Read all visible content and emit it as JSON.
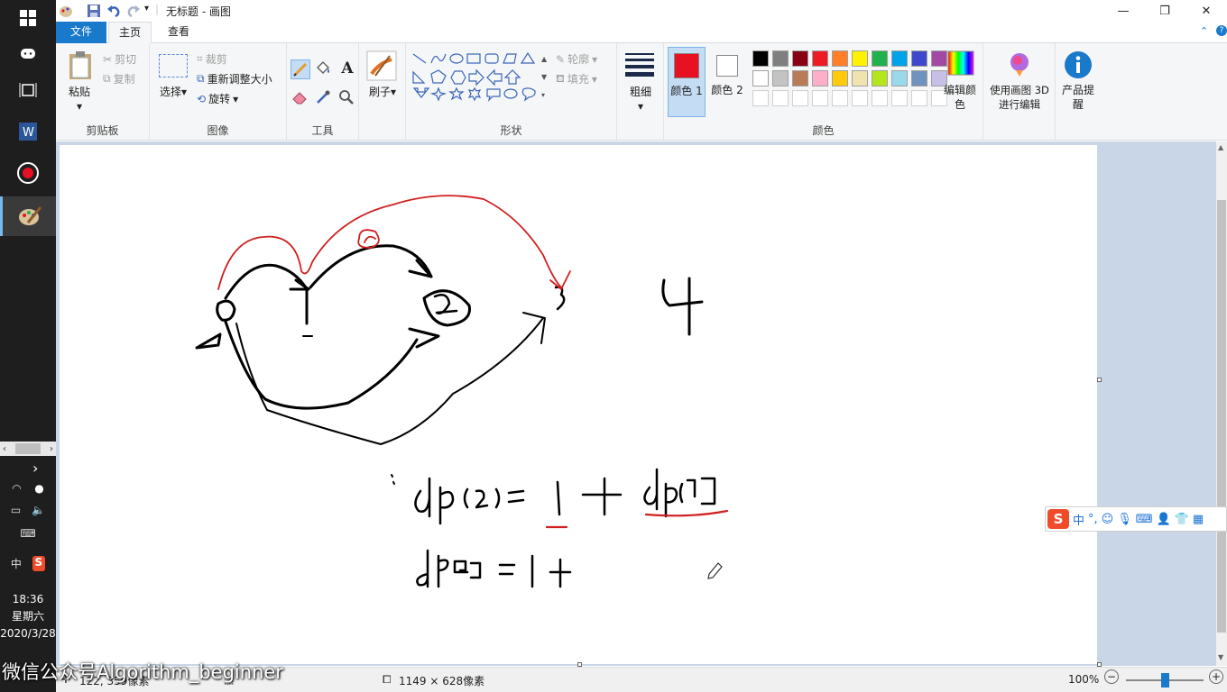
{
  "window": {
    "title": "无标题 - 画图"
  },
  "tabs": [
    "文件",
    "主页",
    "查看"
  ],
  "clipboard": {
    "paste": "粘贴",
    "cut": "剪切",
    "copy": "复制",
    "group": "剪贴板"
  },
  "image": {
    "select": "选择",
    "crop": "裁剪",
    "resize": "重新调整大小",
    "rotate": "旋转",
    "group": "图像"
  },
  "tools": {
    "text_icon": "A",
    "group": "工具"
  },
  "brushes": {
    "label": "刷子"
  },
  "shapes": {
    "outline": "轮廓",
    "fill": "填充",
    "group": "形状"
  },
  "size": {
    "label": "粗细"
  },
  "colors": {
    "color1": "颜色 1",
    "color2": "颜色 2",
    "edit": "编辑颜色",
    "group": "颜色",
    "color1_value": "#e81123",
    "color2_value": "#ffffff",
    "palette_row1": [
      "#000000",
      "#7f7f7f",
      "#880015",
      "#ed1c24",
      "#ff7f27",
      "#fff200",
      "#22b14c",
      "#00a2e8",
      "#3f48cc",
      "#a349a4"
    ],
    "palette_row2": [
      "#ffffff",
      "#c3c3c3",
      "#b97a57",
      "#ffaec9",
      "#ffc90e",
      "#efe4b0",
      "#b5e61d",
      "#99d9ea",
      "#7092be",
      "#c8bfe7"
    ]
  },
  "paint3d": {
    "label": "使用画图 3D 进行编辑"
  },
  "product": {
    "label": "产品提醒"
  },
  "canvas": {
    "text_4": "4",
    "eq1": "dp(2) = 1 + dp[1]",
    "eq2": "dp[2] = 1 +"
  },
  "status": {
    "cursor": "122, 359像素",
    "dimensions": "1149 × 628像素",
    "zoom": "100%"
  },
  "taskbar": {
    "time": "18:36",
    "weekday": "星期六",
    "date": "2020/3/28",
    "ime_lang": "中"
  },
  "ime": {
    "lang": "中",
    "punct": "°,"
  },
  "watermark": "微信公众号Algorithm_beginner"
}
